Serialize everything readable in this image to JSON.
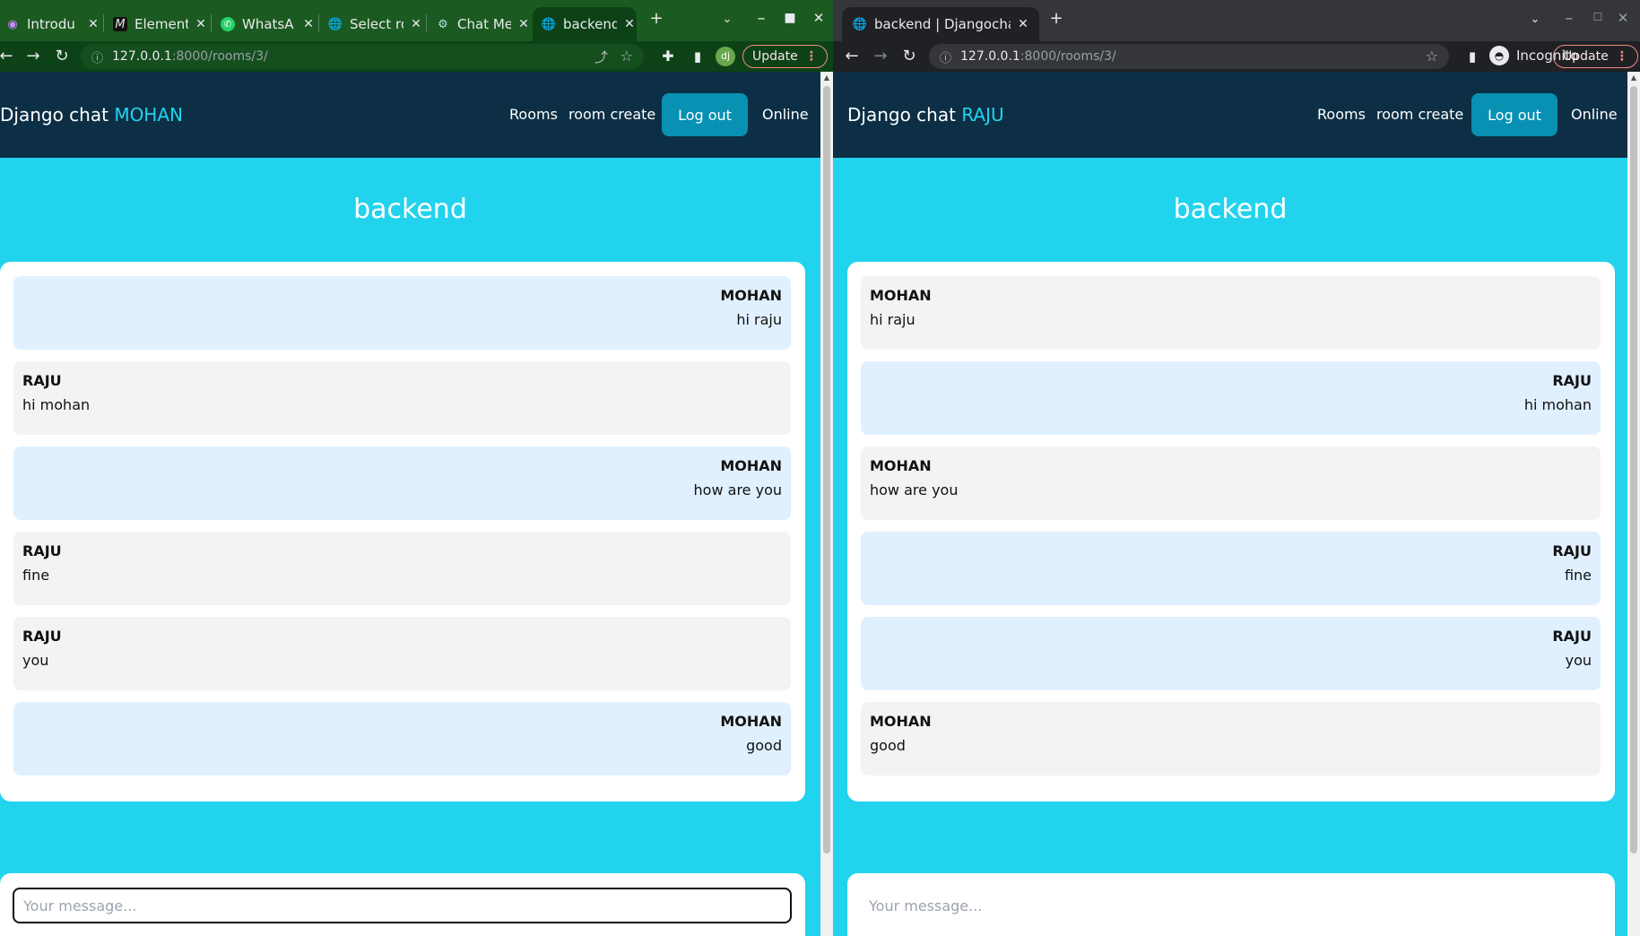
{
  "left_window": {
    "tabs": [
      {
        "title": "Introdu",
        "icon": "sphere-icon"
      },
      {
        "title": "Element",
        "icon": "m-logo-icon"
      },
      {
        "title": "WhatsA",
        "icon": "whatsapp-icon"
      },
      {
        "title": "Select ro",
        "icon": "globe-icon"
      },
      {
        "title": "Chat Me",
        "icon": "chatgpt-icon"
      },
      {
        "title": "backend",
        "icon": "globe-icon"
      }
    ],
    "url_host": "127.0.0.1",
    "url_path": ":8000/rooms/3/",
    "avatar_initials": "dj",
    "update_label": "Update",
    "brand": "Django chat",
    "username": "MOHAN",
    "nav": {
      "rooms": "Rooms",
      "room_create": "room create",
      "logout": "Log out",
      "online": "Online"
    },
    "room_title": "backend",
    "messages": [
      {
        "author": "MOHAN",
        "text": "hi raju",
        "mine": true
      },
      {
        "author": "RAJU",
        "text": "hi mohan",
        "mine": false
      },
      {
        "author": "MOHAN",
        "text": "how are you",
        "mine": true
      },
      {
        "author": "RAJU",
        "text": "fine",
        "mine": false
      },
      {
        "author": "RAJU",
        "text": "you",
        "mine": false
      },
      {
        "author": "MOHAN",
        "text": "good",
        "mine": true
      }
    ],
    "message_placeholder": "Your message..."
  },
  "right_window": {
    "tabs": [
      {
        "title": "backend | Djangochat",
        "icon": "globe-icon"
      }
    ],
    "url_host": "127.0.0.1",
    "url_path": ":8000/rooms/3/",
    "incognito_label": "Incognito",
    "update_label": "Update",
    "brand": "Django chat",
    "username": "RAJU",
    "nav": {
      "rooms": "Rooms",
      "room_create": "room create",
      "logout": "Log out",
      "online": "Online"
    },
    "room_title": "backend",
    "messages": [
      {
        "author": "MOHAN",
        "text": "hi raju",
        "mine": false
      },
      {
        "author": "RAJU",
        "text": "hi mohan",
        "mine": true
      },
      {
        "author": "MOHAN",
        "text": "how are you",
        "mine": false
      },
      {
        "author": "RAJU",
        "text": "fine",
        "mine": true
      },
      {
        "author": "RAJU",
        "text": "you",
        "mine": true
      },
      {
        "author": "MOHAN",
        "text": "good",
        "mine": false
      }
    ],
    "message_placeholder": "Your message..."
  },
  "colors": {
    "navbar": "#0c2f45",
    "page_bg": "#22d3ee",
    "accent": "#22d3ee",
    "logout_button": "#0891b2",
    "own_message": "#e0f0ff",
    "other_message": "#f3f3f3"
  }
}
